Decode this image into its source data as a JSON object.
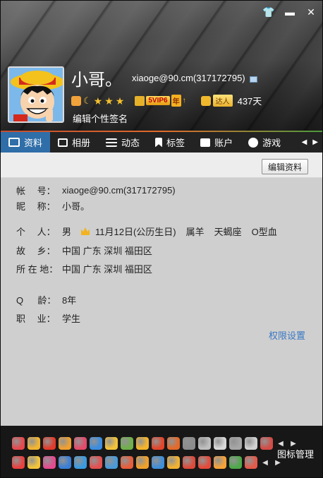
{
  "window": {
    "controls": [
      "skin-icon",
      "minimize-icon",
      "close-icon"
    ],
    "glyphs": {
      "skin": "👕",
      "minimize": "▬",
      "close": "✕"
    }
  },
  "profile": {
    "nickname": "小哥。",
    "account": "xiaoge@90.cm(317172795)",
    "vip_tag": "5VIP6",
    "vip_year": "年",
    "vip_up": "↑",
    "daren_label": "达人",
    "days": "437天",
    "signature": "编辑个性签名",
    "stars": [
      "★",
      "★",
      "★"
    ],
    "moon": "☾"
  },
  "tabs": [
    {
      "label": "资料",
      "active": true
    },
    {
      "label": "相册"
    },
    {
      "label": "动态"
    },
    {
      "label": "标签"
    },
    {
      "label": "账户"
    },
    {
      "label": "游戏"
    }
  ],
  "tab_arrows": {
    "left": "◀",
    "right": "▶"
  },
  "content": {
    "edit_button": "编辑资料",
    "rows": [
      {
        "key": "帐　 号：",
        "value": "xiaoge@90.cm(317172795)"
      },
      {
        "key": "昵　 称：",
        "value": "小哥。"
      },
      {
        "key": "个　 人：",
        "gender": "男",
        "birthday": "11月12日(公历生日)",
        "zodiac": "属羊",
        "sign": "天蝎座",
        "blood": "O型血"
      },
      {
        "key": "故　 乡：",
        "value": "中国 广东 深圳 福田区"
      },
      {
        "key": "所 在 地：",
        "value": "中国 广东 深圳 福田区"
      },
      {
        "key": "Q 　 龄：",
        "value": "8年"
      },
      {
        "key": "职　 业：",
        "value": "学生"
      }
    ],
    "permission_link": "权限设置"
  },
  "bottom": {
    "manage_label": "图标管理",
    "arrow_left": "◀",
    "arrow_right": "▶",
    "row1_colors": [
      "#e5484d",
      "#f2b531",
      "#e23b2b",
      "#f0a030",
      "#e44a6a",
      "#3a8de0",
      "#f3c23a",
      "#6fb04a",
      "#f6b42a",
      "#e2452b",
      "#e46a2a",
      "#8c8c8c",
      "#bfbfbf",
      "#d8d8d8",
      "#a6a6a6",
      "#d0d0d0",
      "#d34c46"
    ],
    "row2_colors": [
      "#e8413f",
      "#f2c43a",
      "#e44a8f",
      "#3a7fd6",
      "#3a9be0",
      "#e45050",
      "#4a9ad8",
      "#e85d3a",
      "#f0a029",
      "#3f8ed8",
      "#f2b231",
      "#dd4a3a",
      "#e34a3a",
      "#f7a238",
      "#4fa84a",
      "#e35a4a"
    ]
  }
}
